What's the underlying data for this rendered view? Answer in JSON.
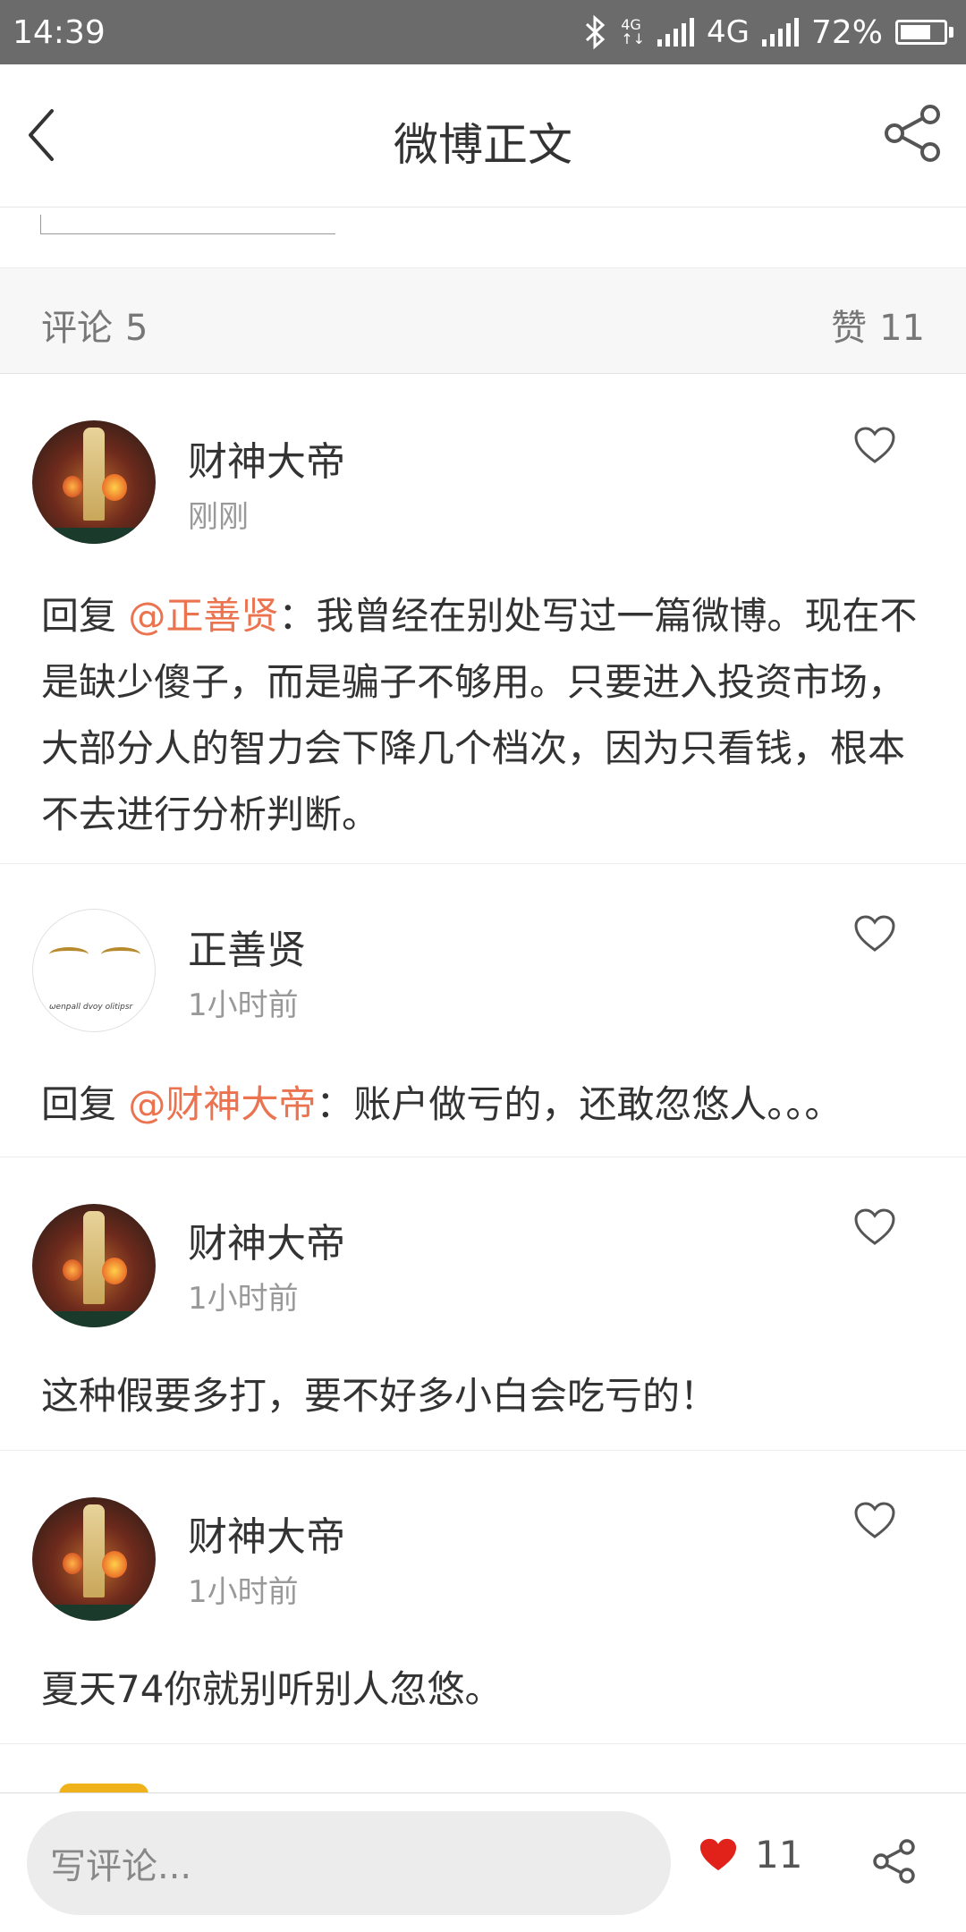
{
  "status_bar": {
    "time": "14:39",
    "network_small": "4G",
    "network": "4G",
    "battery": "72%"
  },
  "header": {
    "title": "微博正文"
  },
  "stats": {
    "comments_label": "评论",
    "comments_count": "5",
    "likes_label": "赞",
    "likes_count": "11"
  },
  "comments": [
    {
      "user": "财神大帝",
      "time": "刚刚",
      "prefix": "回复 ",
      "mention": "@正善贤",
      "text": "：我曾经在别处写过一篇微博。现在不是缺少傻子，而是骗子不够用。只要进入投资市场，大部分人的智力会下降几个档次，因为只看钱，根本不去进行分析判断。"
    },
    {
      "user": "正善贤",
      "time": "1小时前",
      "prefix": "回复 ",
      "mention": "@财神大帝",
      "text": "：账户做亏的，还敢忽悠人。。。"
    },
    {
      "user": "财神大帝",
      "time": "1小时前",
      "text": "这种假要多打，要不好多小白会吃亏的！"
    },
    {
      "user": "财神大帝",
      "time": "1小时前",
      "text": "夏天74你就别听别人忽悠。"
    }
  ],
  "bottom_bar": {
    "input_placeholder": "写评论...",
    "like_count": "11"
  },
  "colors": {
    "accent": "#eb7350",
    "like_red": "#e0221b",
    "status_bar": "#6b6b6b"
  }
}
